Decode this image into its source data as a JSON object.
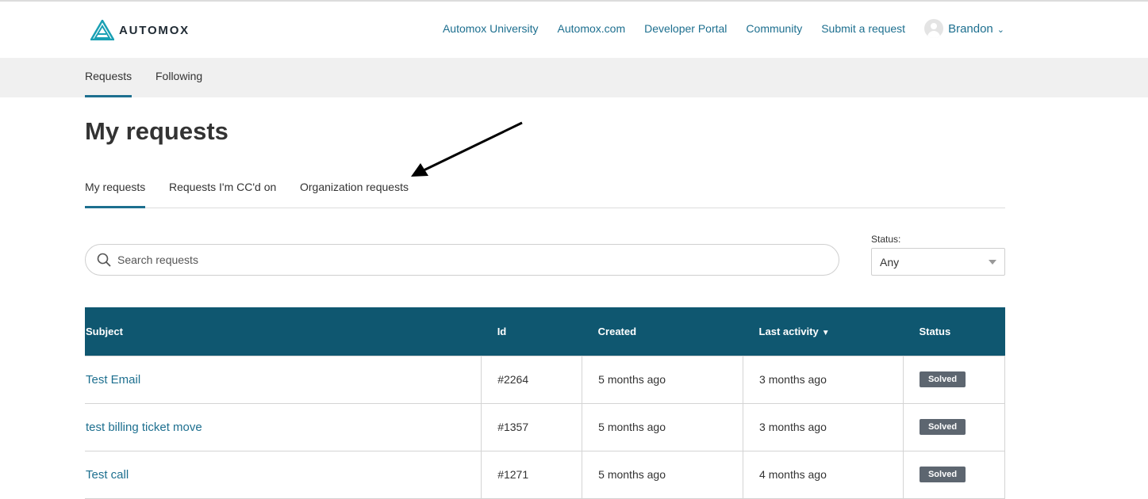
{
  "brand": {
    "name": "AUTOMOX"
  },
  "nav": {
    "links": [
      "Automox University",
      "Automox.com",
      "Developer Portal",
      "Community",
      "Submit a request"
    ],
    "user_name": "Brandon",
    "chevron": "⌄"
  },
  "subnav": {
    "requests": "Requests",
    "following": "Following"
  },
  "page": {
    "title": "My requests"
  },
  "tabs": {
    "my_requests": "My requests",
    "cc": "Requests I'm CC'd on",
    "org": "Organization requests"
  },
  "search": {
    "placeholder": "Search requests"
  },
  "status_filter": {
    "label": "Status:",
    "value": "Any"
  },
  "table": {
    "columns": {
      "subject": "Subject",
      "id": "Id",
      "created": "Created",
      "last_activity": "Last activity",
      "status": "Status"
    },
    "sort_indicator": "▼",
    "rows": [
      {
        "subject": "Test Email",
        "id": "#2264",
        "created": "5 months ago",
        "last_activity": "3 months ago",
        "status": "Solved"
      },
      {
        "subject": "test billing ticket move",
        "id": "#1357",
        "created": "5 months ago",
        "last_activity": "3 months ago",
        "status": "Solved"
      },
      {
        "subject": "Test call",
        "id": "#1271",
        "created": "5 months ago",
        "last_activity": "4 months ago",
        "status": "Solved"
      }
    ]
  },
  "colors": {
    "accent": "#1d6f8f",
    "table_header": "#0f5770",
    "badge": "#5d6670"
  },
  "icons": {
    "logo": "automox-logo-icon",
    "search": "search-icon",
    "avatar": "avatar-icon",
    "arrow": "annotation-arrow"
  }
}
